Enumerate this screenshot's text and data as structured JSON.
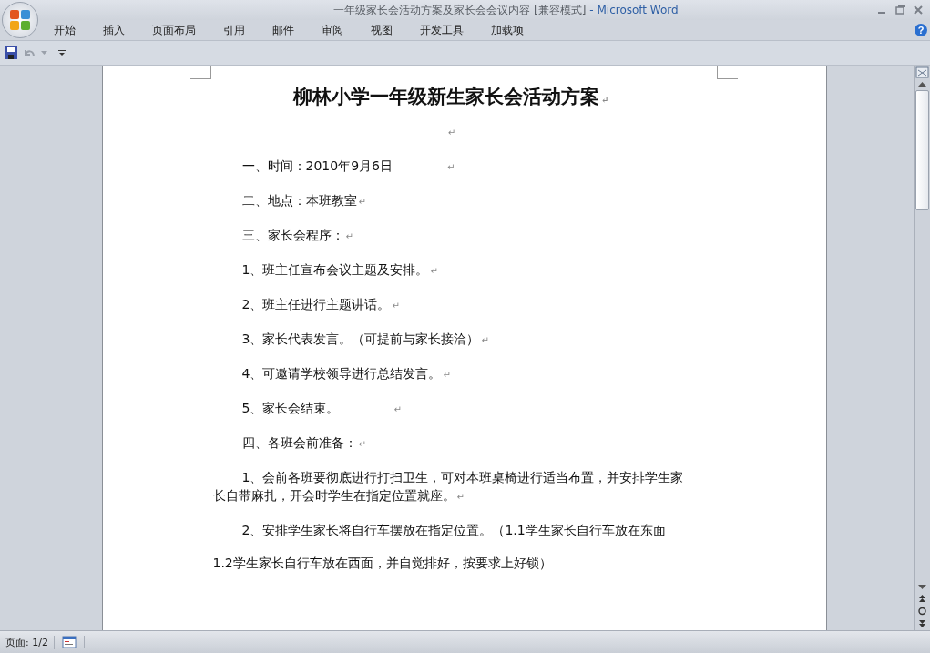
{
  "window": {
    "title": "一年级家长会活动方案及家长会会议内容 [兼容模式]",
    "app": "- Microsoft Word"
  },
  "ribbon_tabs": [
    {
      "label": "开始",
      "selected": false
    },
    {
      "label": "插入",
      "selected": false
    },
    {
      "label": "页面布局",
      "selected": false
    },
    {
      "label": "引用",
      "selected": false
    },
    {
      "label": "邮件",
      "selected": false
    },
    {
      "label": "审阅",
      "selected": false
    },
    {
      "label": "视图",
      "selected": false
    },
    {
      "label": "开发工具",
      "selected": false
    },
    {
      "label": "加载项",
      "selected": false
    }
  ],
  "document": {
    "paragraphs": [
      {
        "kind": "title",
        "text": "柳林小学一年级新生家长会活动方案",
        "mark": "↵"
      },
      {
        "kind": "empty",
        "mark": "↵"
      },
      {
        "kind": "body",
        "text": "一、时间：2010年9月6日",
        "mark": "↵",
        "tab": true
      },
      {
        "kind": "body",
        "text": "二、地点：本班教室",
        "mark": "↵"
      },
      {
        "kind": "body",
        "text": "三、家长会程序：",
        "mark": "↵"
      },
      {
        "kind": "body",
        "text": "1、班主任宣布会议主题及安排。",
        "mark": "↵"
      },
      {
        "kind": "body",
        "text": "2、班主任进行主题讲话。",
        "mark": "↵"
      },
      {
        "kind": "body",
        "text": "3、家长代表发言。（可提前与家长接洽）",
        "mark": "↵"
      },
      {
        "kind": "body",
        "text": "4、可邀请学校领导进行总结发言。",
        "mark": "↵"
      },
      {
        "kind": "body",
        "text": "5、家长会结束。",
        "mark": "↵",
        "tab": true
      },
      {
        "kind": "body",
        "text": "四、各班会前准备：",
        "mark": "↵"
      },
      {
        "kind": "body",
        "text": "1、会前各班要彻底进行打扫卫生，可对本班桌椅进行适当布置，并安排学生家长自带麻扎，开会时学生在指定位置就座。",
        "mark": "↵"
      },
      {
        "kind": "body",
        "text": "2、安排学生家长将自行车摆放在指定位置。（1.1学生家长自行车放在东面"
      },
      {
        "kind": "continued",
        "text": "1.2学生家长自行车放在西面，并自觉排好，按要求上好锁）"
      }
    ]
  },
  "help": "?",
  "status_bar": {
    "page": "页面: 1/2"
  }
}
